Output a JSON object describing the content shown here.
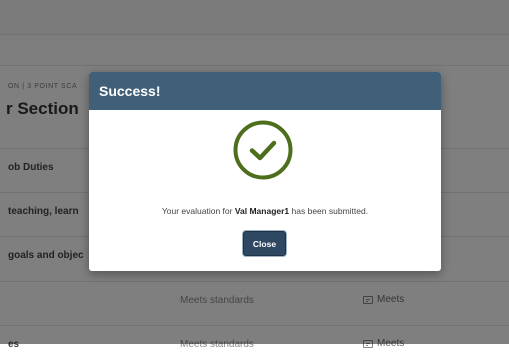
{
  "background": {
    "scale_label": "ON | 3 POINT SCA",
    "section_title": "r Section",
    "rows": [
      {
        "label": "ob Duties",
        "rating": "",
        "comment": ""
      },
      {
        "label": "teaching, learn",
        "rating": "",
        "comment": ""
      },
      {
        "label": "goals and objec",
        "rating": "",
        "comment": ""
      },
      {
        "label": "",
        "rating": "Meets standards",
        "comment": "Meets"
      },
      {
        "label": "es",
        "rating": "Meets standards",
        "comment": "Meets"
      }
    ]
  },
  "modal": {
    "title": "Success!",
    "message_prefix": "Your evaluation for ",
    "message_name": "Val Manager1",
    "message_suffix": " has been submitted.",
    "close_label": "Close"
  },
  "colors": {
    "header_bg": "#40607a",
    "check_green": "#4d6e1c",
    "button_bg": "#2f4861"
  },
  "icons": {
    "success": "check-circle-icon",
    "comment": "comment-icon"
  }
}
